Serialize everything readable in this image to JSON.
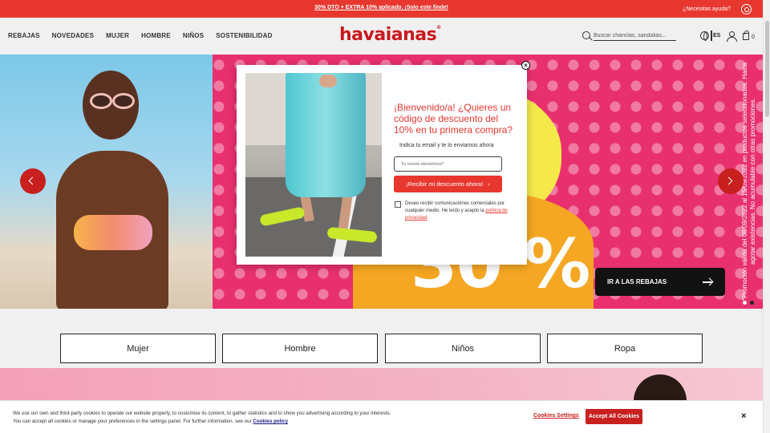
{
  "promo_bar": {
    "text": "30% DTO + EXTRA 10% aplicado. ¡Solo este finde!",
    "help_label": "¿Necesitas ayuda?",
    "help_icon": "whatsapp-icon"
  },
  "header": {
    "nav_items": [
      "REBAJAS",
      "NOVEDADES",
      "MUJER",
      "HOMBRE",
      "NIÑOS",
      "SOSTENIBILIDAD"
    ],
    "logo": "havaianas",
    "logo_mark": "®",
    "search_placeholder": "Buscar chanclas, sandalias...",
    "language": "ES",
    "cart_count": "0"
  },
  "hero": {
    "big_text": "30 %",
    "cta_label": "IR A LAS REBAJAS",
    "legal_text": "*Promoción válida del 08/09/2022 al 15/09/2022 en productos seleccionados. Hasta agotar existencias. No acumulable con otras promociones.",
    "slides_total": 2,
    "slide_active": 2,
    "colors": {
      "pink": "#e8306e",
      "yellow": "#f4e84a",
      "orange": "#f5a623"
    }
  },
  "modal": {
    "title": "¡Bienvenido/a! ¿Quieres un código de descuento del 10% en tu primera compra?",
    "subtitle": "Indica tu email y te lo enviamos ahora",
    "email_placeholder": "Tu correo electrónico*",
    "submit_label": "¡Recibir mi descuento ahora!",
    "submit_arrow": "›",
    "consent_text": "Deseo recibir comunicaciones comerciales por cualquier medio. He leído y acepto la",
    "consent_link": "política de privacidad",
    "consent_suffix": ".",
    "close_glyph": "×"
  },
  "categories": [
    "Mujer",
    "Hombre",
    "Niños",
    "Ropa"
  ],
  "cookie_bar": {
    "text_line1": "We use our own and third-party cookies to operate our website properly, to customise its content, to gather statistics and to show you advertising according to your interests.",
    "text_line2": "You can accept all cookies or manage your preferences in the settings panel. For further information, see our",
    "policy_link": "Cookies policy",
    "settings_label": "Cookies Settings",
    "accept_label": "Accept All Cookies",
    "close_glyph": "×"
  },
  "colors": {
    "brand_red": "#c8181e",
    "promo_red": "#e8372f"
  }
}
